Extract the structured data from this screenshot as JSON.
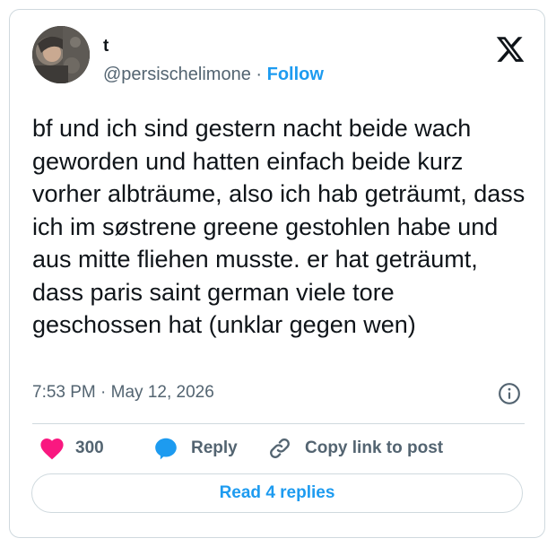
{
  "author": {
    "name": "t",
    "handle": "@persischelimone",
    "separator": " · ",
    "follow_label": "Follow"
  },
  "tweet": {
    "text": "bf und ich sind gestern nacht beide wach geworden und hatten einfach beide kurz vorher albträume, also ich hab geträumt, dass ich im søstrene greene gestohlen habe und aus mitte fliehen musste. er hat geträumt, dass paris saint german viele tore geschossen hat (unklar gegen wen)",
    "time": "7:53 PM",
    "date_separator": " · ",
    "date": "May 12, 2026"
  },
  "actions": {
    "likes_count": "300",
    "reply_label": "Reply",
    "copy_link_label": "Copy link to post"
  },
  "read_replies_label": "Read 4 replies",
  "icons": {
    "logo": "x-logo-icon",
    "info": "info-icon",
    "like": "heart-icon",
    "reply": "speech-bubble-icon",
    "copy": "link-icon"
  },
  "colors": {
    "accent": "#1d9bf0",
    "like": "#f91880",
    "text": "#0f1419",
    "secondary": "#536471",
    "border": "#cfd9de"
  }
}
